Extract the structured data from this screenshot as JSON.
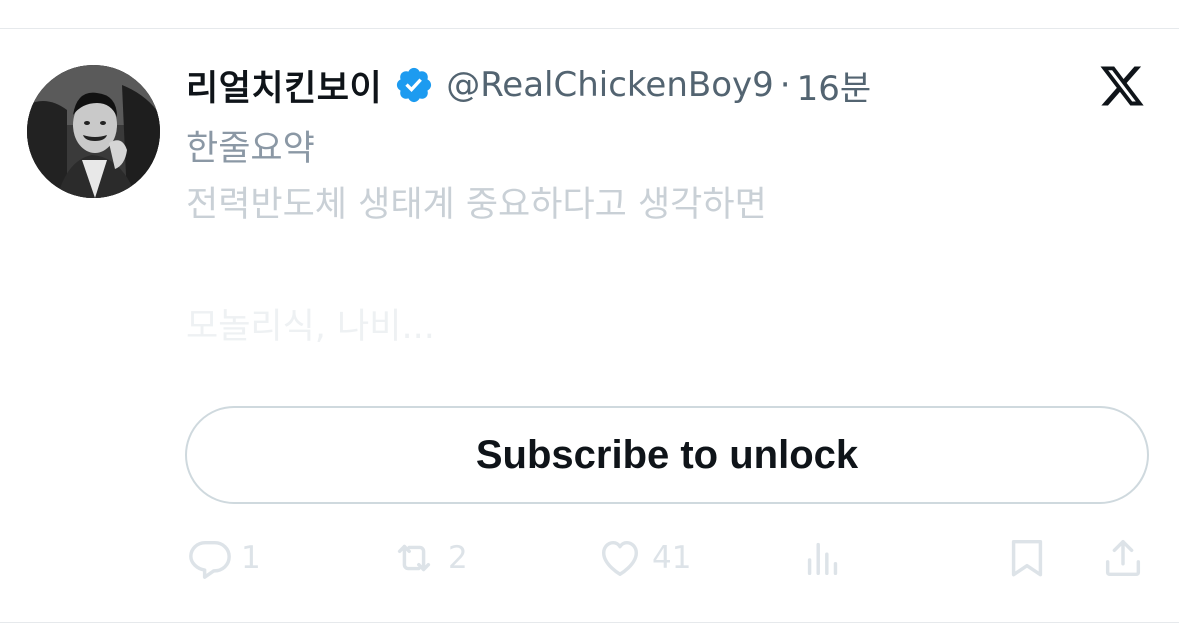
{
  "tweet": {
    "display_name": "리얼치킨보이",
    "handle": "@RealChickenBoy9",
    "separator": "·",
    "time": "16분",
    "line1": "한줄요약",
    "line2": "전력반도체 생태계 중요하다고 생각하면",
    "line3": "모놀리식, 나비..."
  },
  "subscribe": {
    "label": "Subscribe to unlock"
  },
  "actions": {
    "replies": "1",
    "reposts": "2",
    "likes": "41"
  },
  "colors": {
    "verified": "#1d9bf0",
    "text_primary": "#0f1419",
    "text_secondary": "#536471",
    "border": "#cfd9de"
  },
  "icons": {
    "verified": "verified-badge-icon",
    "x_logo": "x-logo-icon",
    "reply": "reply-icon",
    "repost": "repost-icon",
    "like": "heart-icon",
    "views": "views-icon",
    "bookmark": "bookmark-icon",
    "share": "share-icon"
  }
}
